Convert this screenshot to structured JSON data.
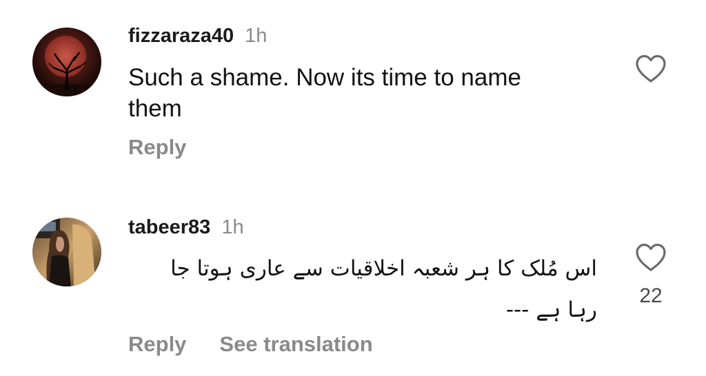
{
  "comments": [
    {
      "username": "fizzaraza40",
      "time": "1h",
      "text_line1": "Such a shame. Now its time to name",
      "text_line2": "them",
      "reply_label": "Reply",
      "avatar_icon": "tree-under-red-moon-avatar",
      "like_icon": "heart-outline-icon"
    },
    {
      "username": "tabeer83",
      "time": "1h",
      "text_line1": "اس مُلک کا ہر شعبہ اخلاقیات سے عاری ہوتا جا",
      "text_line2": "رہا ہے ---",
      "reply_label": "Reply",
      "translate_label": "See translation",
      "like_count": "22",
      "avatar_icon": "person-in-car-avatar",
      "like_icon": "heart-outline-icon"
    }
  ],
  "colors": {
    "username": "#1a1a1a",
    "muted": "#8a8a8a",
    "text": "#121212",
    "background": "#ffffff"
  }
}
